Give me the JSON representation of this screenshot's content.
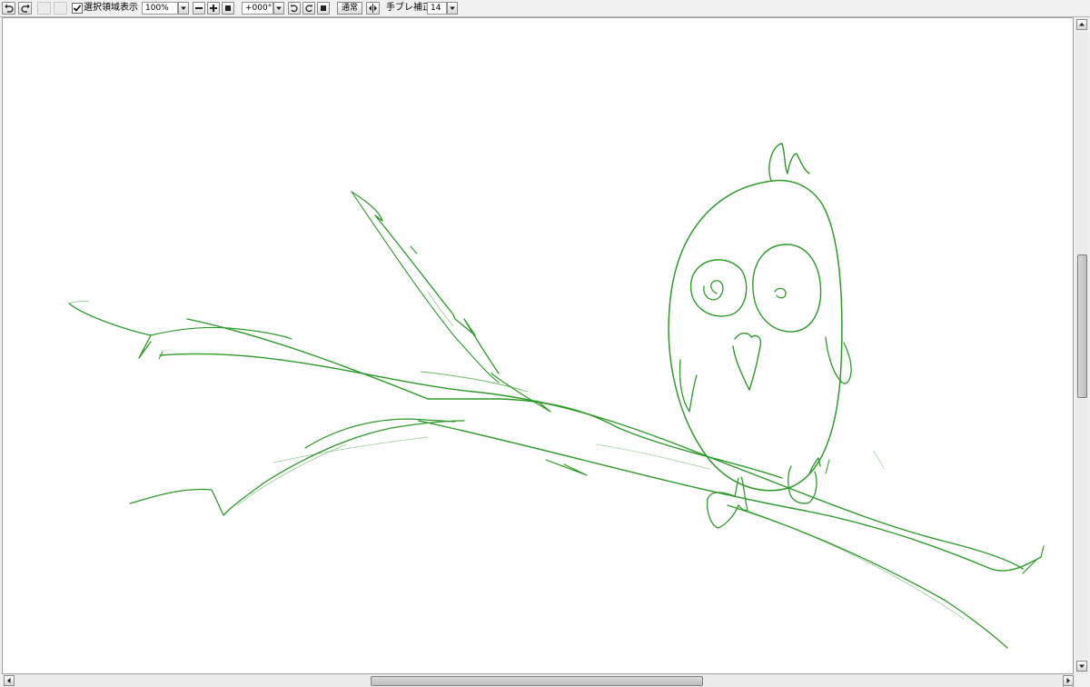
{
  "toolbar": {
    "show_selection_label": "選択領域表示",
    "show_selection_checked": true,
    "zoom_value": "100%",
    "rotation_value": "+000°",
    "blend_mode_label": "通常",
    "stabilizer_label": "手ブレ補正",
    "stabilizer_value": "14"
  },
  "icons": [
    "undo-icon",
    "redo-icon",
    "checkbox-icon",
    "chevron-down-icon",
    "zoom-out-icon",
    "zoom-in-icon",
    "zoom-reset-icon",
    "rotate-ccw-icon",
    "rotate-cw-icon",
    "rotate-reset-icon",
    "flip-horizontal-icon"
  ],
  "colors": {
    "stroke": "#2e9a2a",
    "canvas": "#ffffff",
    "chrome": "#f0f0f0"
  },
  "canvas_content": "green line sketch of an owl perched on a tree branch"
}
